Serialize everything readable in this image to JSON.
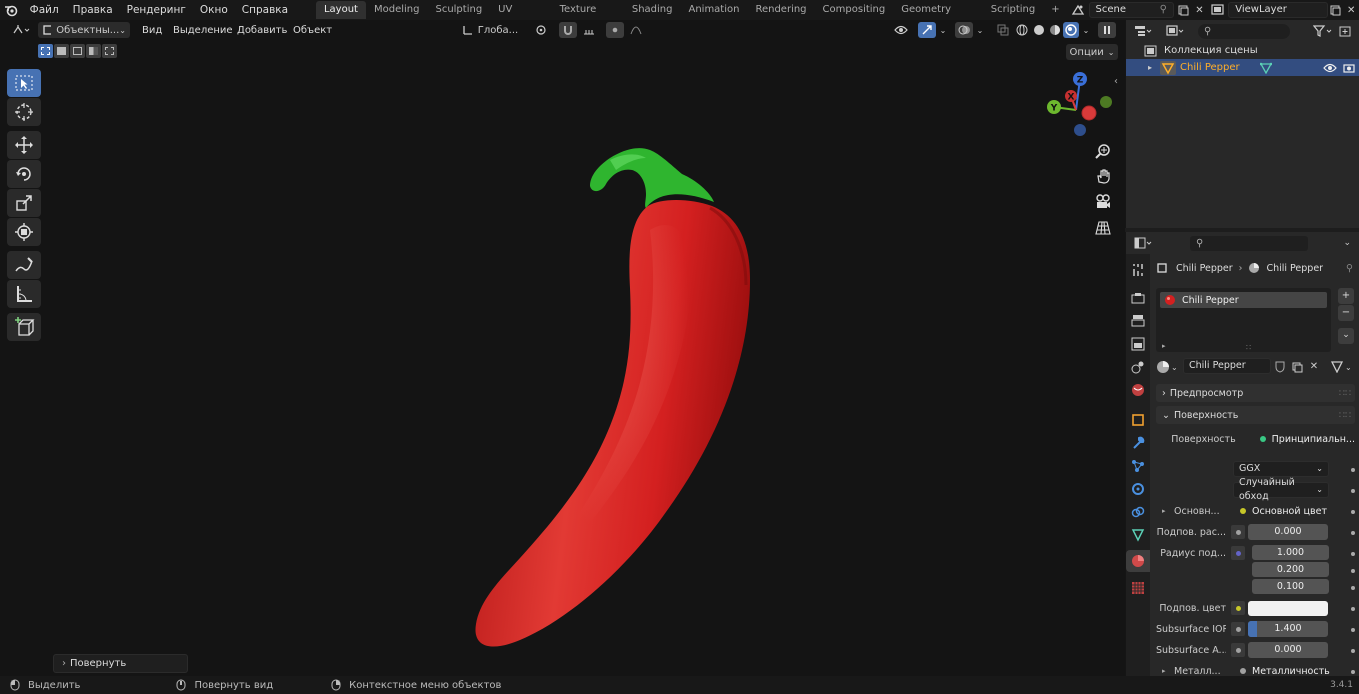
{
  "topbar": {
    "menus": [
      "Файл",
      "Правка",
      "Рендеринг",
      "Окно",
      "Справка"
    ],
    "workspace_tabs": [
      "Layout",
      "Modeling",
      "Sculpting",
      "UV Editing",
      "Texture Paint",
      "Shading",
      "Animation",
      "Rendering",
      "Compositing",
      "Geometry Nodes",
      "Scripting"
    ],
    "active_tab": "Layout",
    "add_tab": "+",
    "scene": "Scene",
    "view_layer": "ViewLayer"
  },
  "viewport": {
    "mode": "Объектны...",
    "menus": [
      "Вид",
      "Выделение",
      "Добавить",
      "Объект"
    ],
    "transform_orientation": "Глоба...",
    "options_label": "Опции",
    "gizmo": {
      "x": "X",
      "y": "Y",
      "z": "Z"
    },
    "last_op": "Повернуть"
  },
  "outliner": {
    "collection": "Коллекция сцены",
    "object": "Chili Pepper"
  },
  "properties": {
    "breadcrumb_object": "Chili Pepper",
    "breadcrumb_material": "Chili Pepper",
    "material_slot": "Chili Pepper",
    "material_name": "Chili Pepper",
    "panel_preview": "Предпросмотр",
    "panel_surface": "Поверхность",
    "surface_label": "Поверхность",
    "surface_value": "Принципиальн...",
    "distribution": "GGX",
    "subsurface_method": "Случайный обход",
    "rows": [
      {
        "label": "Основн...",
        "value": "Основной цвет",
        "socket": "#c7c729"
      },
      {
        "label": "Подпов. рас...",
        "value": "0.000",
        "socket": "#a1a1a1"
      },
      {
        "label": "Радиус под...",
        "values": [
          "1.000",
          "0.200",
          "0.100"
        ],
        "socket": "#6363c7"
      },
      {
        "label": "Подпов. цвет",
        "value": "",
        "socket": "#c7c729"
      },
      {
        "label": "Subsurface IOR",
        "value": "1.400",
        "socket": "#a1a1a1"
      },
      {
        "label": "Subsurface A...",
        "value": "0.000",
        "socket": "#a1a1a1"
      },
      {
        "label": "Металл...",
        "value": "Металличность",
        "socket": "#a1a1a1"
      }
    ]
  },
  "status": {
    "select": "Выделить",
    "rotate_view": "Повернуть вид",
    "context_menu": "Контекстное меню объектов",
    "version": "3.4.1"
  },
  "colors": {
    "accent": "#4772b3",
    "active_object_text": "#ffaf29",
    "pepper_red": "#d42020",
    "stem_green": "#2fb52f"
  }
}
